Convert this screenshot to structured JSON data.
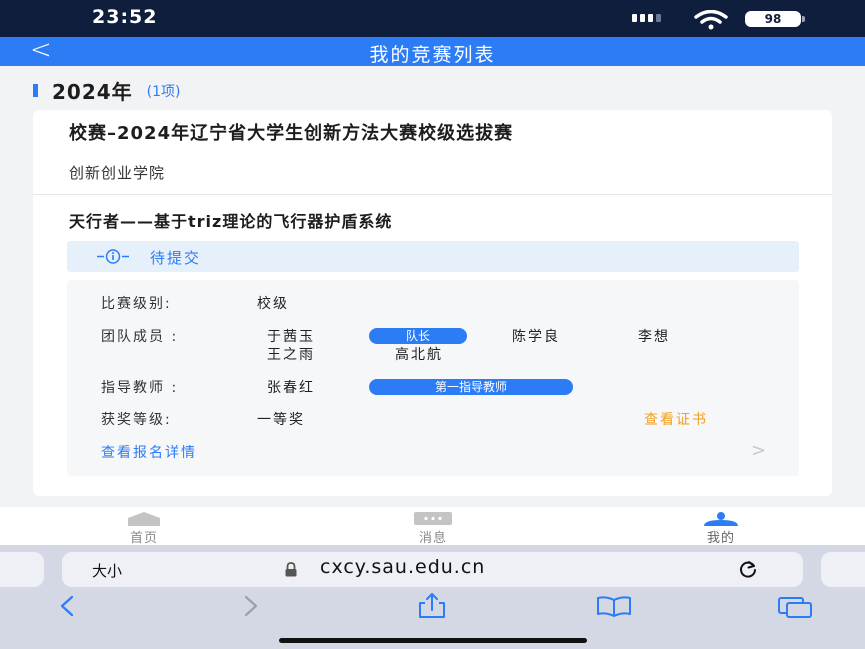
{
  "status_bar": {
    "time": "23:52",
    "battery": "98"
  },
  "nav": {
    "back_label": "<",
    "title": "我的竞赛列表"
  },
  "year_group": {
    "year": "2024年",
    "count": "(1项)"
  },
  "competition": {
    "title": "校赛–2024年辽宁省大学生创新方法大赛校级选拔赛",
    "organizer": "创新创业学院",
    "project_name": "天行者——基于triz理论的飞行器护盾系统",
    "status": "待提交",
    "level_label": "比赛级别:",
    "level_value": "校级",
    "team_label": "团队成员 :",
    "team_members": [
      "于茜玉",
      "陈学良",
      "李想",
      "王之雨",
      "高北航"
    ],
    "leader_tag": "队长",
    "advisor_label": "指导教师 :",
    "advisor_name": "张春红",
    "advisor_tag": "第一指导教师",
    "award_label": "获奖等级:",
    "award_value": "一等奖",
    "view_certificate": "查看证书",
    "view_details": "查看报名详情",
    "arrow": ">"
  },
  "tabs": [
    {
      "label": "首页",
      "icon": "home-icon"
    },
    {
      "label": "消息",
      "icon": "message-icon"
    },
    {
      "label": "我的",
      "icon": "user-icon"
    }
  ],
  "browser": {
    "size_label": "大小",
    "url": "cxcy.sau.edu.cn"
  },
  "colors": {
    "accent": "#2c7cf6",
    "status_bar": "#0f1e3c",
    "certificate_link": "#f0a020"
  }
}
